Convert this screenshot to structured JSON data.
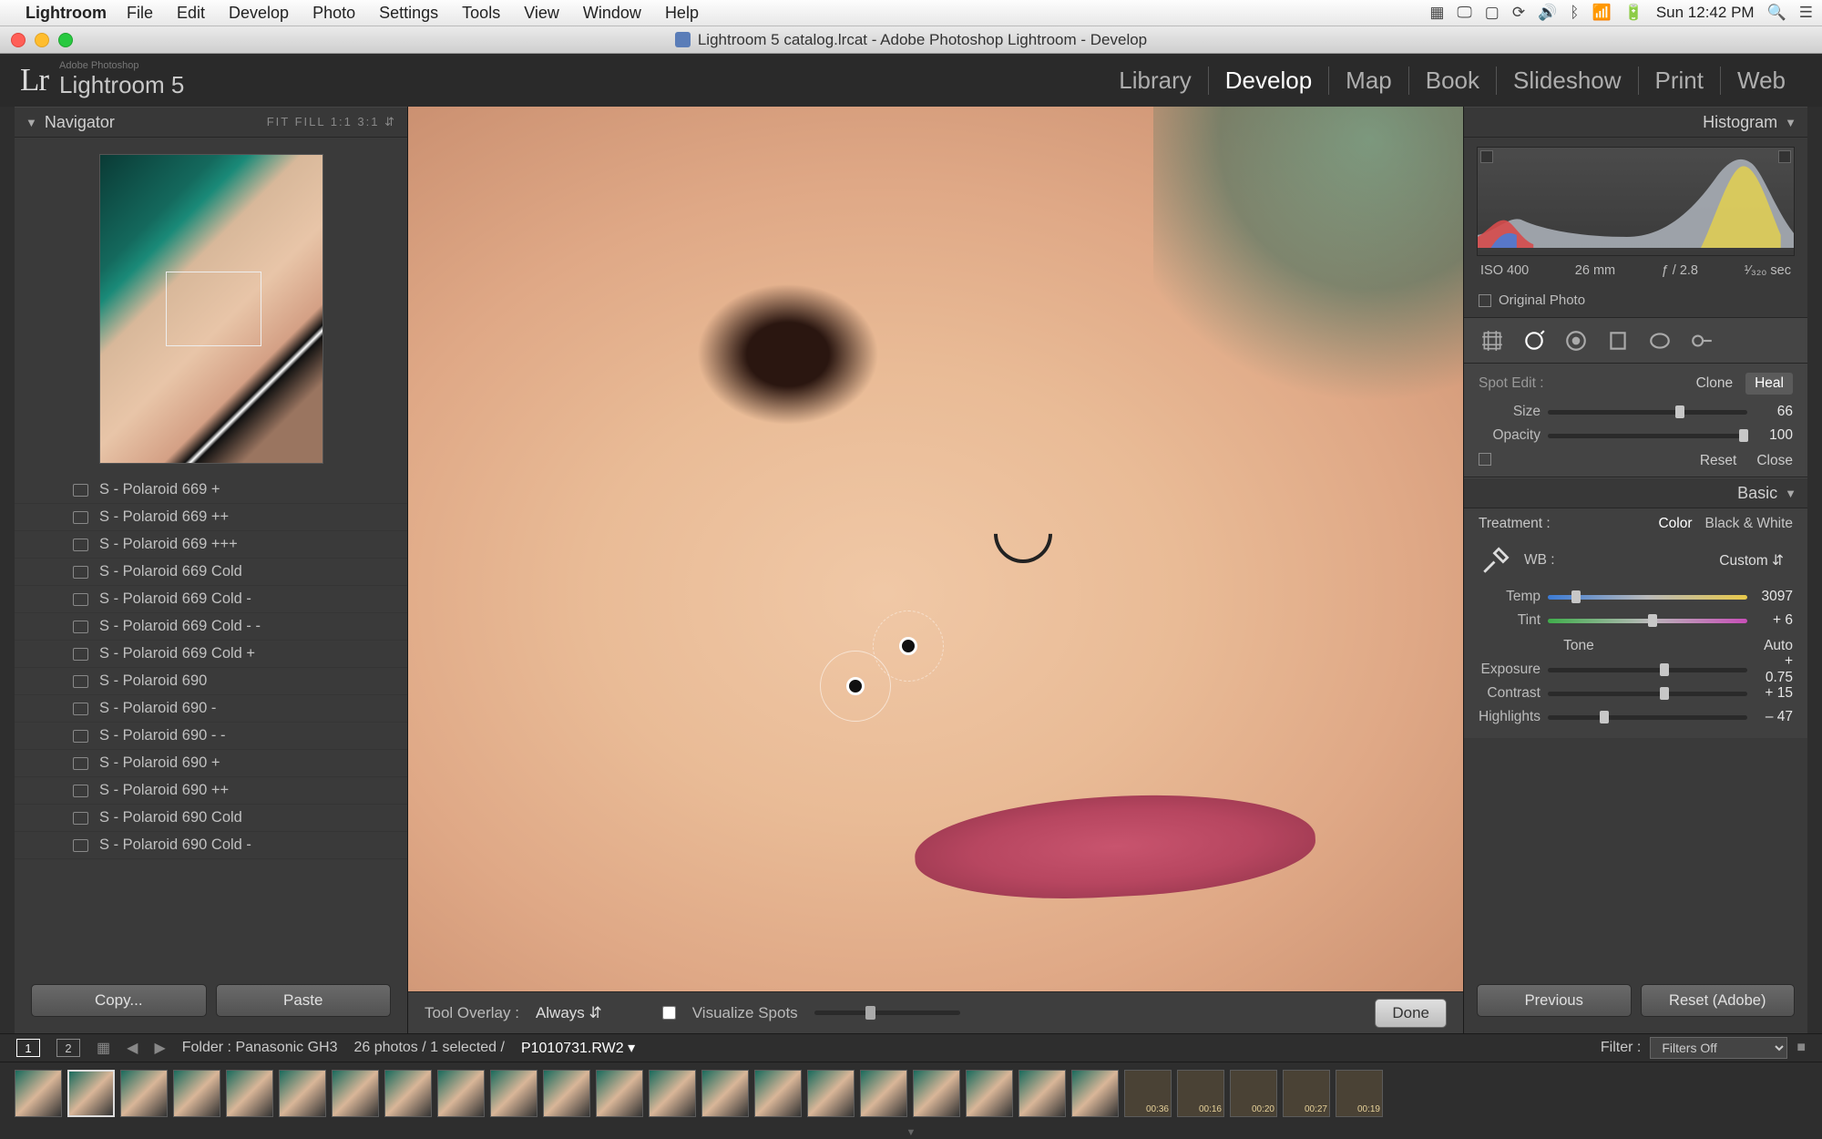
{
  "menubar": {
    "app": "Lightroom",
    "items": [
      "File",
      "Edit",
      "Develop",
      "Photo",
      "Settings",
      "Tools",
      "View",
      "Window",
      "Help"
    ],
    "clock": "Sun 12:42 PM"
  },
  "window_title": "Lightroom 5 catalog.lrcat - Adobe Photoshop Lightroom - Develop",
  "brand": {
    "small": "Adobe Photoshop",
    "name": "Lightroom 5",
    "mark": "Lr"
  },
  "modules": [
    "Library",
    "Develop",
    "Map",
    "Book",
    "Slideshow",
    "Print",
    "Web"
  ],
  "active_module": "Develop",
  "navigator": {
    "title": "Navigator",
    "opts": "FIT   FILL   1:1   3:1  ⇵"
  },
  "presets": [
    "S - Polaroid 669 +",
    "S - Polaroid 669 ++",
    "S - Polaroid 669 +++",
    "S - Polaroid 669 Cold",
    "S - Polaroid 669 Cold -",
    "S - Polaroid 669 Cold - -",
    "S - Polaroid 669 Cold +",
    "S - Polaroid 690",
    "S - Polaroid 690 -",
    "S - Polaroid 690 - -",
    "S - Polaroid 690 +",
    "S - Polaroid 690 ++",
    "S - Polaroid 690 Cold",
    "S - Polaroid 690 Cold -"
  ],
  "left_buttons": {
    "copy": "Copy...",
    "paste": "Paste"
  },
  "center_toolbar": {
    "tool_overlay_label": "Tool Overlay :",
    "tool_overlay_value": "Always",
    "visualize_label": "Visualize Spots",
    "done": "Done"
  },
  "histogram": {
    "title": "Histogram",
    "iso": "ISO 400",
    "focal": "26 mm",
    "aperture": "ƒ / 2.8",
    "shutter": "¹⁄₃₂₀ sec",
    "original_label": "Original Photo"
  },
  "spot_edit": {
    "label": "Spot Edit :",
    "tabs": [
      "Clone",
      "Heal"
    ],
    "active_tab": "Heal",
    "size_label": "Size",
    "size_value": "66",
    "opacity_label": "Opacity",
    "opacity_value": "100",
    "reset": "Reset",
    "close": "Close"
  },
  "basic": {
    "title": "Basic",
    "treatment_label": "Treatment :",
    "treatment_tabs": [
      "Color",
      "Black & White"
    ],
    "treatment_active": "Color",
    "wb_label": "WB :",
    "wb_value": "Custom",
    "temp_label": "Temp",
    "temp_value": "3097",
    "tint_label": "Tint",
    "tint_value": "+ 6",
    "tone_label": "Tone",
    "auto": "Auto",
    "exposure_label": "Exposure",
    "exposure_value": "+ 0.75",
    "contrast_label": "Contrast",
    "contrast_value": "+ 15",
    "highlights_label": "Highlights",
    "highlights_value": "– 47"
  },
  "right_buttons": {
    "previous": "Previous",
    "reset": "Reset (Adobe)"
  },
  "info": {
    "folder_label": "Folder : Panasonic GH3",
    "count_label": "26 photos / 1 selected /",
    "filename": "P1010731.RW2",
    "filter_label": "Filter :",
    "filter_value": "Filters Off"
  },
  "video_times": [
    "00:36",
    "00:16",
    "00:20",
    "00:27",
    "00:19"
  ]
}
